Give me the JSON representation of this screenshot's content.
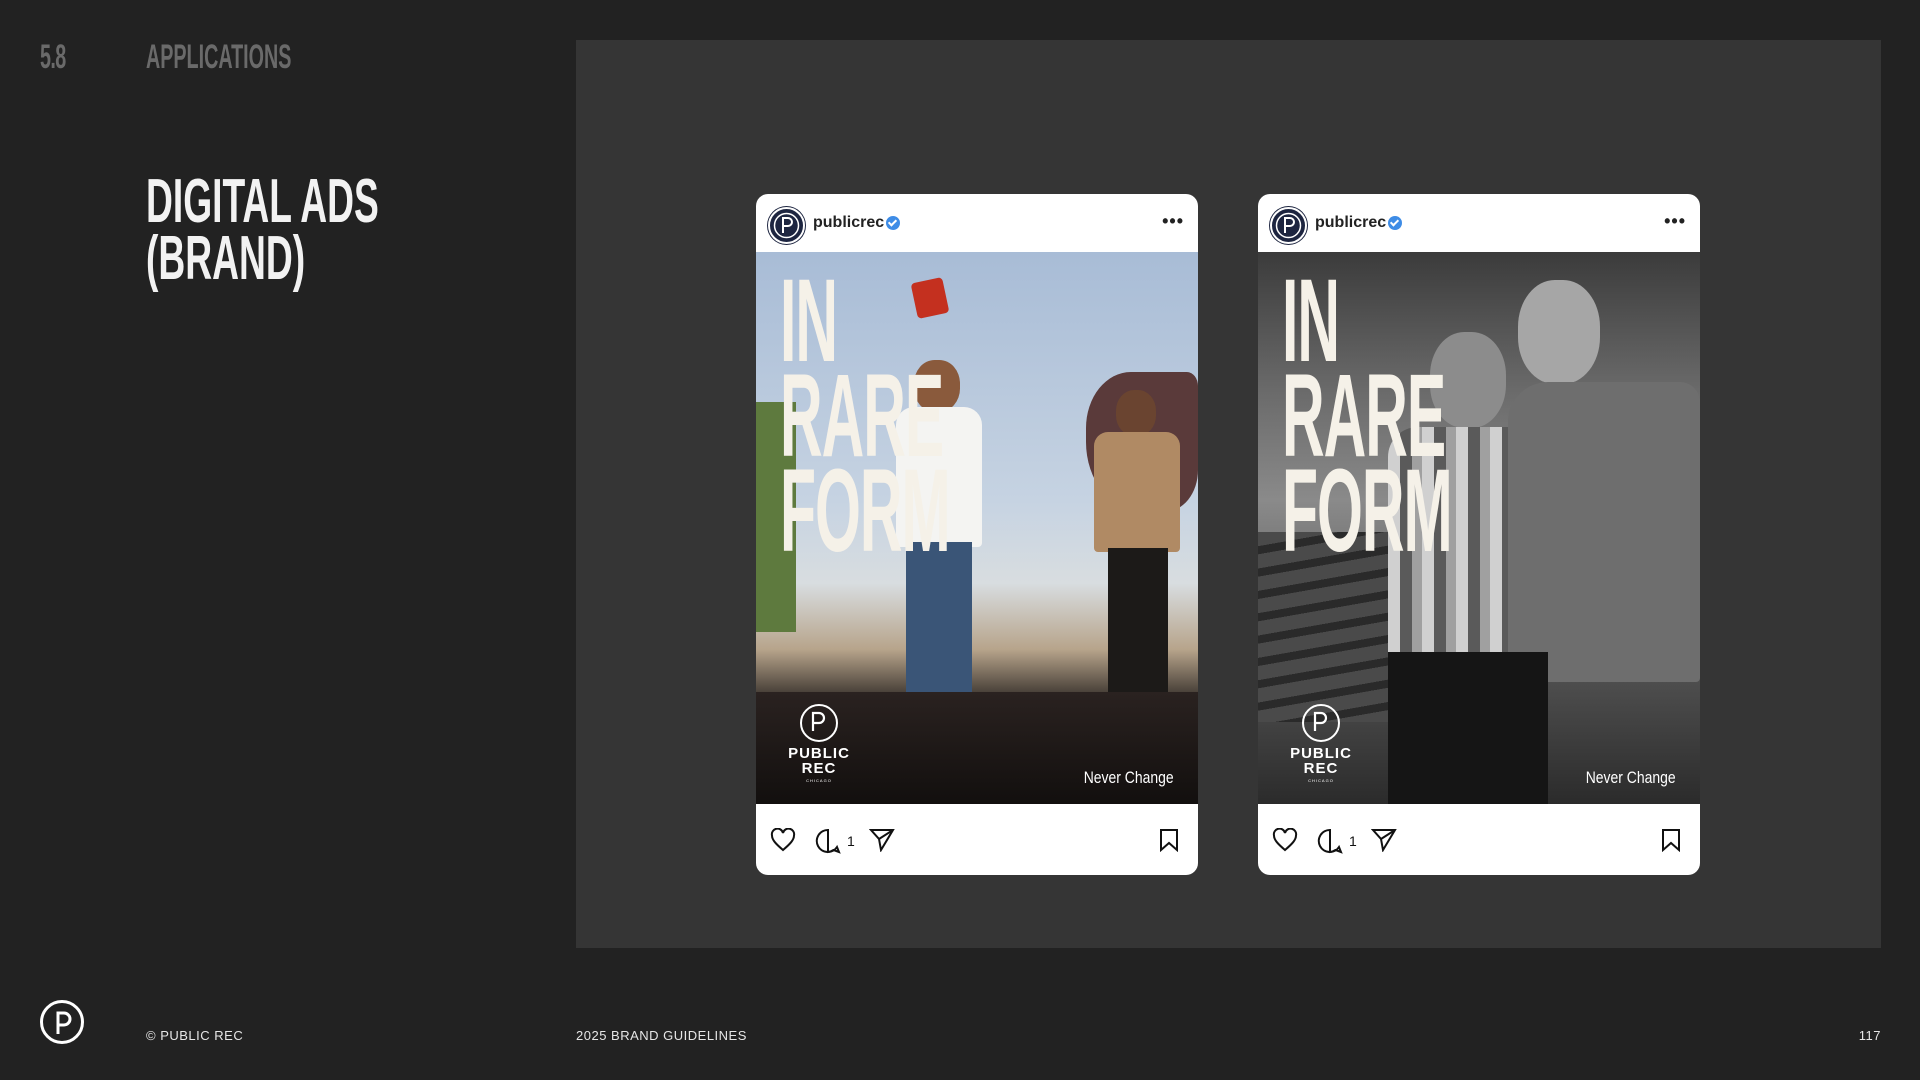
{
  "section": {
    "number": "5.8",
    "title": "APPLICATIONS"
  },
  "heading": {
    "line1": "DIGITAL ADS",
    "line2": "(BRAND)"
  },
  "posts": [
    {
      "handle": "publicrec",
      "headline": [
        "IN",
        "RARE",
        "FORM"
      ],
      "brand_word_1": "PUBLIC",
      "brand_word_2": "REC",
      "brand_sub": "CHICAGO",
      "tagline": "Never Change",
      "comment_count": "1",
      "photo_style": "color"
    },
    {
      "handle": "publicrec",
      "headline": [
        "IN",
        "RARE",
        "FORM"
      ],
      "brand_word_1": "PUBLIC",
      "brand_word_2": "REC",
      "brand_sub": "CHICAGO",
      "tagline": "Never Change",
      "comment_count": "1",
      "photo_style": "bw"
    }
  ],
  "footer": {
    "copyright": "© PUBLIC REC",
    "doc_title": "2025 BRAND GUIDELINES",
    "page_number": "117"
  },
  "colors": {
    "background": "#222222",
    "stage": "#353535",
    "verified": "#3e8ce6",
    "avatar": "#1d2540"
  },
  "icons": [
    "p-logo-icon",
    "verified-icon",
    "more-icon",
    "heart-icon",
    "comment-icon",
    "share-icon",
    "bookmark-icon"
  ]
}
